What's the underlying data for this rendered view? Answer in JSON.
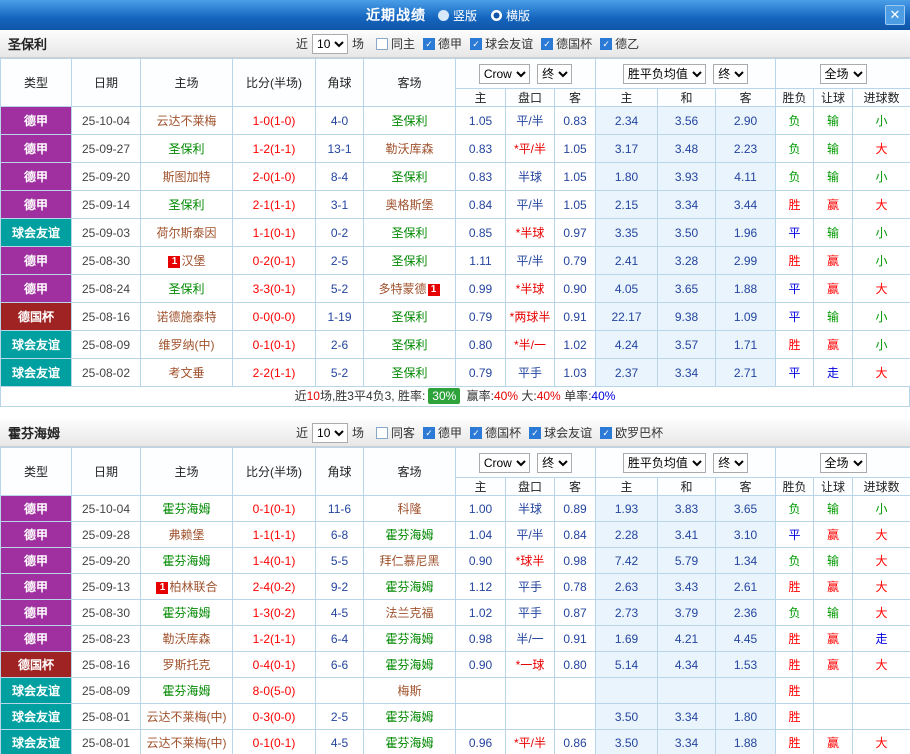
{
  "titlebar": {
    "title": "近期战绩",
    "radios": [
      {
        "label": "竖版",
        "checked": false
      },
      {
        "label": "横版",
        "checked": true
      }
    ],
    "close_label": "✕"
  },
  "table": {
    "left_headers": [
      "类型",
      "日期",
      "主场",
      "比分(半场)",
      "角球",
      "客场"
    ],
    "sub_headers": [
      "主",
      "盘口",
      "客",
      "主",
      "和",
      "客",
      "胜负",
      "让球",
      "进球数"
    ],
    "selects": {
      "odds_source": "Crow",
      "final1": "终",
      "avg": "胜平负均值",
      "final2": "终",
      "scope": "全场"
    }
  },
  "colors": {
    "league": {
      "德甲": "#A0309F",
      "球会友谊": "#00A0A0",
      "德国杯": "#A02323"
    },
    "focus_team": "#008800",
    "opponent_team": "#A0522D",
    "score": "#FF0000",
    "corner": "#24459E",
    "odds": "#24459E",
    "handicap_plain": "#24459E",
    "handicap_star": "#E60000",
    "result": {
      "胜": "#FF0000",
      "平": "#0000DD",
      "负": "#009900"
    },
    "cover": {
      "赢": "#FF0000",
      "走": "#0000DD",
      "输": "#009900"
    },
    "goals": {
      "大": "#FF0000",
      "走": "#0000DD",
      "小": "#009900"
    }
  },
  "sections": [
    {
      "team": "圣保利",
      "filter": {
        "near": "近",
        "count": "10",
        "games": "场",
        "checkboxes": [
          {
            "label": "同主",
            "checked": false
          },
          {
            "label": "德甲",
            "checked": true
          },
          {
            "label": "球会友谊",
            "checked": true
          },
          {
            "label": "德国杯",
            "checked": true
          },
          {
            "label": "德乙",
            "checked": true
          }
        ]
      },
      "rows": [
        {
          "league": "德甲",
          "date": "25-10-04",
          "home": {
            "name": "云达不莱梅",
            "focus": false
          },
          "score": "1-0(1-0)",
          "corner": "4-0",
          "away": {
            "name": "圣保利",
            "focus": true
          },
          "odds": [
            "1.05",
            "平/半",
            "0.83"
          ],
          "avg": [
            "2.34",
            "3.56",
            "2.90"
          ],
          "result": "负",
          "cover": "输",
          "goals": "小"
        },
        {
          "league": "德甲",
          "date": "25-09-27",
          "home": {
            "name": "圣保利",
            "focus": true
          },
          "score": "1-2(1-1)",
          "corner": "13-1",
          "away": {
            "name": "勒沃库森",
            "focus": false
          },
          "odds": [
            "0.83",
            "*平/半",
            "1.05"
          ],
          "avg": [
            "3.17",
            "3.48",
            "2.23"
          ],
          "result": "负",
          "cover": "输",
          "goals": "大"
        },
        {
          "league": "德甲",
          "date": "25-09-20",
          "home": {
            "name": "斯图加特",
            "focus": false
          },
          "score": "2-0(1-0)",
          "corner": "8-4",
          "away": {
            "name": "圣保利",
            "focus": true
          },
          "odds": [
            "0.83",
            "半球",
            "1.05"
          ],
          "avg": [
            "1.80",
            "3.93",
            "4.11"
          ],
          "result": "负",
          "cover": "输",
          "goals": "小"
        },
        {
          "league": "德甲",
          "date": "25-09-14",
          "home": {
            "name": "圣保利",
            "focus": true
          },
          "score": "2-1(1-1)",
          "corner": "3-1",
          "away": {
            "name": "奥格斯堡",
            "focus": false
          },
          "odds": [
            "0.84",
            "平/半",
            "1.05"
          ],
          "avg": [
            "2.15",
            "3.34",
            "3.44"
          ],
          "result": "胜",
          "cover": "赢",
          "goals": "大"
        },
        {
          "league": "球会友谊",
          "date": "25-09-03",
          "home": {
            "name": "荷尔斯泰因",
            "focus": false
          },
          "score": "1-1(0-1)",
          "corner": "0-2",
          "away": {
            "name": "圣保利",
            "focus": true
          },
          "odds": [
            "0.85",
            "*半球",
            "0.97"
          ],
          "avg": [
            "3.35",
            "3.50",
            "1.96"
          ],
          "result": "平",
          "cover": "输",
          "goals": "小"
        },
        {
          "league": "德甲",
          "date": "25-08-30",
          "home": {
            "name": "汉堡",
            "focus": false,
            "badge": "1",
            "badge_pos": "before"
          },
          "score": "0-2(0-1)",
          "corner": "2-5",
          "away": {
            "name": "圣保利",
            "focus": true
          },
          "odds": [
            "1.11",
            "平/半",
            "0.79"
          ],
          "avg": [
            "2.41",
            "3.28",
            "2.99"
          ],
          "result": "胜",
          "cover": "赢",
          "goals": "小"
        },
        {
          "league": "德甲",
          "date": "25-08-24",
          "home": {
            "name": "圣保利",
            "focus": true
          },
          "score": "3-3(0-1)",
          "corner": "5-2",
          "away": {
            "name": "多特蒙德",
            "focus": false,
            "badge": "1",
            "badge_pos": "after"
          },
          "odds": [
            "0.99",
            "*半球",
            "0.90"
          ],
          "avg": [
            "4.05",
            "3.65",
            "1.88"
          ],
          "result": "平",
          "cover": "赢",
          "goals": "大"
        },
        {
          "league": "德国杯",
          "date": "25-08-16",
          "home": {
            "name": "诺德施泰特",
            "focus": false
          },
          "score": "0-0(0-0)",
          "corner": "1-19",
          "away": {
            "name": "圣保利",
            "focus": true
          },
          "odds": [
            "0.79",
            "*两球半",
            "0.91"
          ],
          "avg": [
            "22.17",
            "9.38",
            "1.09"
          ],
          "result": "平",
          "cover": "输",
          "goals": "小"
        },
        {
          "league": "球会友谊",
          "date": "25-08-09",
          "home": {
            "name": "维罗纳(中)",
            "focus": false
          },
          "score": "0-1(0-1)",
          "corner": "2-6",
          "away": {
            "name": "圣保利",
            "focus": true
          },
          "odds": [
            "0.80",
            "*半/一",
            "1.02"
          ],
          "avg": [
            "4.24",
            "3.57",
            "1.71"
          ],
          "result": "胜",
          "cover": "赢",
          "goals": "小"
        },
        {
          "league": "球会友谊",
          "date": "25-08-02",
          "home": {
            "name": "考文垂",
            "focus": false
          },
          "score": "2-2(1-1)",
          "corner": "5-2",
          "away": {
            "name": "圣保利",
            "focus": true
          },
          "odds": [
            "0.79",
            "平手",
            "1.03"
          ],
          "avg": [
            "2.37",
            "3.34",
            "2.71"
          ],
          "result": "平",
          "cover": "走",
          "goals": "大"
        }
      ],
      "summary": [
        {
          "text": "近",
          "style": "plain"
        },
        {
          "text": "10",
          "style": "red"
        },
        {
          "text": "场,胜3平4负3, 胜率:",
          "style": "plain"
        },
        {
          "text": "30%",
          "style": "badge-green"
        },
        {
          "text": " 赢率:",
          "style": "plain"
        },
        {
          "text": "40%",
          "style": "red"
        },
        {
          "text": " 大:",
          "style": "plain"
        },
        {
          "text": "40%",
          "style": "red"
        },
        {
          "text": " 单率:",
          "style": "plain"
        },
        {
          "text": "40%",
          "style": "blue"
        }
      ]
    },
    {
      "team": "霍芬海姆",
      "filter": {
        "near": "近",
        "count": "10",
        "games": "场",
        "checkboxes": [
          {
            "label": "同客",
            "checked": false
          },
          {
            "label": "德甲",
            "checked": true
          },
          {
            "label": "德国杯",
            "checked": true
          },
          {
            "label": "球会友谊",
            "checked": true
          },
          {
            "label": "欧罗巴杯",
            "checked": true
          }
        ]
      },
      "rows": [
        {
          "league": "德甲",
          "date": "25-10-04",
          "home": {
            "name": "霍芬海姆",
            "focus": true
          },
          "score": "0-1(0-1)",
          "corner": "11-6",
          "away": {
            "name": "科隆",
            "focus": false
          },
          "odds": [
            "1.00",
            "半球",
            "0.89"
          ],
          "avg": [
            "1.93",
            "3.83",
            "3.65"
          ],
          "result": "负",
          "cover": "输",
          "goals": "小"
        },
        {
          "league": "德甲",
          "date": "25-09-28",
          "home": {
            "name": "弗赖堡",
            "focus": false
          },
          "score": "1-1(1-1)",
          "corner": "6-8",
          "away": {
            "name": "霍芬海姆",
            "focus": true
          },
          "odds": [
            "1.04",
            "平/半",
            "0.84"
          ],
          "avg": [
            "2.28",
            "3.41",
            "3.10"
          ],
          "result": "平",
          "cover": "赢",
          "goals": "大"
        },
        {
          "league": "德甲",
          "date": "25-09-20",
          "home": {
            "name": "霍芬海姆",
            "focus": true
          },
          "score": "1-4(0-1)",
          "corner": "5-5",
          "away": {
            "name": "拜仁慕尼黑",
            "focus": false
          },
          "odds": [
            "0.90",
            "*球半",
            "0.98"
          ],
          "avg": [
            "7.42",
            "5.79",
            "1.34"
          ],
          "result": "负",
          "cover": "输",
          "goals": "大"
        },
        {
          "league": "德甲",
          "date": "25-09-13",
          "home": {
            "name": "柏林联合",
            "focus": false,
            "badge": "1",
            "badge_pos": "before"
          },
          "score": "2-4(0-2)",
          "corner": "9-2",
          "away": {
            "name": "霍芬海姆",
            "focus": true
          },
          "odds": [
            "1.12",
            "平手",
            "0.78"
          ],
          "avg": [
            "2.63",
            "3.43",
            "2.61"
          ],
          "result": "胜",
          "cover": "赢",
          "goals": "大"
        },
        {
          "league": "德甲",
          "date": "25-08-30",
          "home": {
            "name": "霍芬海姆",
            "focus": true
          },
          "score": "1-3(0-2)",
          "corner": "4-5",
          "away": {
            "name": "法兰克福",
            "focus": false
          },
          "odds": [
            "1.02",
            "平手",
            "0.87"
          ],
          "avg": [
            "2.73",
            "3.79",
            "2.36"
          ],
          "result": "负",
          "cover": "输",
          "goals": "大"
        },
        {
          "league": "德甲",
          "date": "25-08-23",
          "home": {
            "name": "勒沃库森",
            "focus": false
          },
          "score": "1-2(1-1)",
          "corner": "6-4",
          "away": {
            "name": "霍芬海姆",
            "focus": true
          },
          "odds": [
            "0.98",
            "半/一",
            "0.91"
          ],
          "avg": [
            "1.69",
            "4.21",
            "4.45"
          ],
          "result": "胜",
          "cover": "赢",
          "goals": "走"
        },
        {
          "league": "德国杯",
          "date": "25-08-16",
          "home": {
            "name": "罗斯托克",
            "focus": false
          },
          "score": "0-4(0-1)",
          "corner": "6-6",
          "away": {
            "name": "霍芬海姆",
            "focus": true
          },
          "odds": [
            "0.90",
            "*一球",
            "0.80"
          ],
          "avg": [
            "5.14",
            "4.34",
            "1.53"
          ],
          "result": "胜",
          "cover": "赢",
          "goals": "大"
        },
        {
          "league": "球会友谊",
          "date": "25-08-09",
          "home": {
            "name": "霍芬海姆",
            "focus": true
          },
          "score": "8-0(5-0)",
          "corner": "",
          "away": {
            "name": "梅斯",
            "focus": false
          },
          "odds": [
            "",
            "",
            ""
          ],
          "avg": [
            "",
            "",
            ""
          ],
          "result": "胜",
          "cover": "",
          "goals": ""
        },
        {
          "league": "球会友谊",
          "date": "25-08-01",
          "home": {
            "name": "云达不莱梅(中)",
            "focus": false
          },
          "score": "0-3(0-0)",
          "corner": "2-5",
          "away": {
            "name": "霍芬海姆",
            "focus": true
          },
          "odds": [
            "",
            "",
            ""
          ],
          "avg": [
            "3.50",
            "3.34",
            "1.80"
          ],
          "result": "胜",
          "cover": "",
          "goals": ""
        },
        {
          "league": "球会友谊",
          "date": "25-08-01",
          "home": {
            "name": "云达不莱梅(中)",
            "focus": false
          },
          "score": "0-1(0-1)",
          "corner": "4-5",
          "away": {
            "name": "霍芬海姆",
            "focus": true
          },
          "odds": [
            "0.96",
            "*平/半",
            "0.86"
          ],
          "avg": [
            "3.50",
            "3.34",
            "1.88"
          ],
          "result": "胜",
          "cover": "赢",
          "goals": "大"
        }
      ]
    }
  ]
}
